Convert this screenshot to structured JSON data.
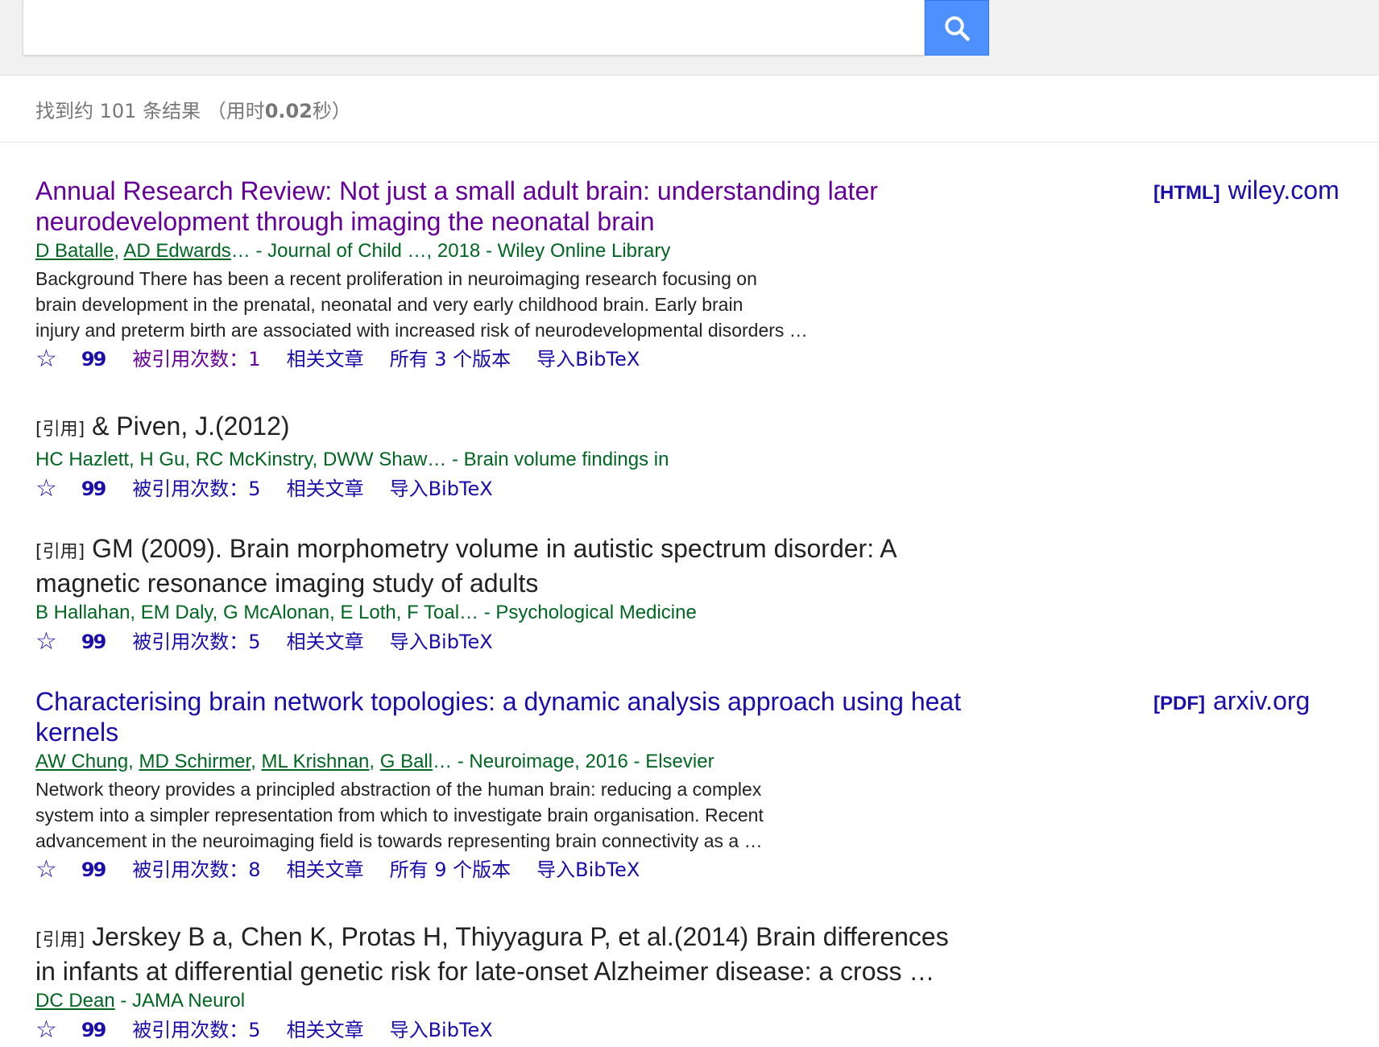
{
  "search": {
    "query": "",
    "placeholder": ""
  },
  "stats": {
    "prefix": "找到约 101 条结果 （用时",
    "time": "0.02",
    "suffix": "秒）"
  },
  "results": [
    {
      "title_line1": "Annual Research Review: Not just a small adult brain: understanding later",
      "title_line2": "neurodevelopment through imaging the neonatal brain",
      "author1": "D Batalle",
      "sep1": ", ",
      "author2": "AD Edwards",
      "meta_rest": "… - Journal of Child …, 2018 - Wiley Online Library",
      "snippet": [
        "Background There has been a recent proliferation in neuroimaging research focusing on",
        "brain development in the prenatal, neonatal and very early childhood brain. Early brain",
        "injury and preterm birth are associated with increased risk of neurodevelopmental disorders …"
      ],
      "cited_by": "被引用次数：1",
      "related": "相关文章",
      "versions": "所有 3 个版本",
      "bibtex": "导入BibTeX",
      "side_type": "[HTML]",
      "side_domain": "wiley.com"
    },
    {
      "cite_tag": "[引用]",
      "title": "& Piven, J.(2012)",
      "meta": "HC Hazlett, H Gu, RC McKinstry, DWW Shaw… - Brain volume findings in",
      "cited_by": "被引用次数：5",
      "related": "相关文章",
      "bibtex": "导入BibTeX"
    },
    {
      "cite_tag": "[引用]",
      "title_line1": "GM (2009). Brain morphometry volume in autistic spectrum disorder: A",
      "title_line2": "magnetic resonance imaging study of adults",
      "meta": "B Hallahan, EM Daly, G McAlonan, E Loth, F Toal… - Psychological Medicine",
      "cited_by": "被引用次数：5",
      "related": "相关文章",
      "bibtex": "导入BibTeX"
    },
    {
      "title_line1": "Characterising brain network topologies: a dynamic analysis approach using heat",
      "title_line2": "kernels",
      "author1": "AW Chung",
      "author2": "MD Schirmer",
      "author3": "ML Krishnan",
      "author4": "G Ball",
      "sep": ", ",
      "meta_rest": "… - Neuroimage, 2016 - Elsevier",
      "snippet": [
        "Network theory provides a principled abstraction of the human brain: reducing a complex",
        "system into a simpler representation from which to investigate brain organisation. Recent",
        "advancement in the neuroimaging field is towards representing brain connectivity as a …"
      ],
      "cited_by": "被引用次数：8",
      "related": "相关文章",
      "versions": "所有 9 个版本",
      "bibtex": "导入BibTeX",
      "side_type": "[PDF]",
      "side_domain": "arxiv.org"
    },
    {
      "cite_tag": "[引用]",
      "title_line1": "Jerskey B a, Chen K, Protas H, Thiyyagura P, et al.(2014) Brain differences",
      "title_line2": "in infants at differential genetic risk for late-onset Alzheimer disease: a cross …",
      "author1": "DC Dean",
      "meta_rest": " - JAMA Neurol",
      "cited_by": "被引用次数：5",
      "related": "相关文章",
      "bibtex": "导入BibTeX"
    }
  ],
  "icons": {
    "star": "☆",
    "quote": "99"
  },
  "colors": {
    "link": "#1a0dab",
    "visited": "#660099",
    "meta": "#006621",
    "search_button": "#4d90fe"
  }
}
